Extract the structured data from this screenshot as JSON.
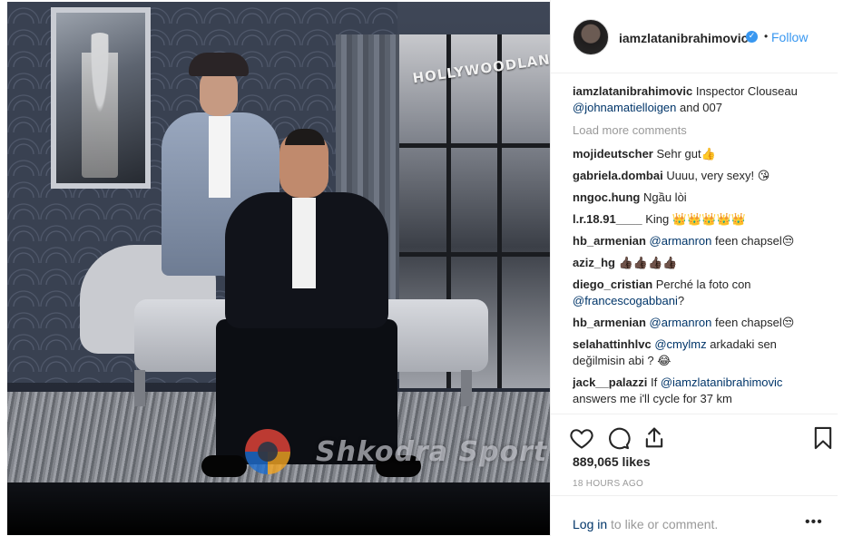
{
  "header": {
    "username": "iamzlatanibrahimovic",
    "separator": "•",
    "follow_label": "Follow"
  },
  "caption": {
    "username": "iamzlatanibrahimovic",
    "text_before": " Inspector Clouseau",
    "mention": "@johnamatielloigen",
    "text_after": " and 007"
  },
  "load_more_label": "Load more comments",
  "comments": [
    {
      "user": "mojideutscher",
      "text": " Sehr gut👍",
      "mention": "",
      "after": ""
    },
    {
      "user": "gabriela.dombai",
      "text": " Uuuu, very sexy! 😘",
      "mention": "",
      "after": ""
    },
    {
      "user": "nngoc.hung",
      "text": " Ngầu lòi",
      "mention": "",
      "after": ""
    },
    {
      "user": "l.r.18.91____",
      "text": " King 👑👑👑👑👑",
      "mention": "",
      "after": ""
    },
    {
      "user": "hb_armenian",
      "text": " ",
      "mention": "@armanron",
      "after": " feen chapsel😒"
    },
    {
      "user": "aziz_hg",
      "text": " 👍🏿👍🏿👍🏿👍🏿",
      "mention": "",
      "after": ""
    },
    {
      "user": "diego_cristian",
      "text": " Perché la foto con ",
      "mention": "@francescogabbani",
      "after": "?"
    },
    {
      "user": "hb_armenian",
      "text": " ",
      "mention": "@armanron",
      "after": " feen chapsel😒"
    },
    {
      "user": "selahattinhlvc",
      "text": " ",
      "mention": "@cmylmz",
      "after": " arkadaki sen değilmisin abi ? 😂"
    },
    {
      "user": "jack__palazzi",
      "text": " If ",
      "mention": "@iamzlatanibrahimovic",
      "after": " answers me i'll cycle for 37 km"
    }
  ],
  "likes_text": "889,065 likes",
  "timestamp": "18 HOURS AGO",
  "login": {
    "link_label": "Log in",
    "rest_text": " to like or comment."
  },
  "more_label": "•••",
  "photo": {
    "sign_text": "HOLLYWOODLAND",
    "watermark_text": "Shkodra Sport"
  },
  "colors": {
    "accent": "#3897f0",
    "mention": "#003569",
    "muted": "#999999",
    "text": "#262626"
  },
  "icons": [
    "heart-icon",
    "comment-icon",
    "share-icon",
    "bookmark-icon",
    "verified-icon",
    "more-options-icon"
  ]
}
